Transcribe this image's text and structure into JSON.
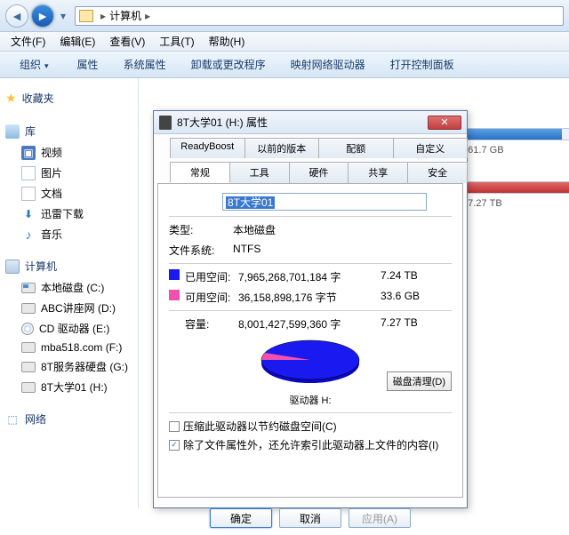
{
  "nav": {
    "location": "计算机"
  },
  "menu": {
    "file": "文件(F)",
    "edit": "编辑(E)",
    "view": "查看(V)",
    "tools": "工具(T)",
    "help": "帮助(H)"
  },
  "toolbar": {
    "organize": "组织",
    "properties": "属性",
    "sysprops": "系统属性",
    "uninstall": "卸载或更改程序",
    "mapdrive": "映射网络驱动器",
    "ctrlpanel": "打开控制面板"
  },
  "sidebar": {
    "fav": "收藏夹",
    "lib": "库",
    "lib_items": [
      "视频",
      "图片",
      "文档",
      "迅雷下载",
      "音乐"
    ],
    "computer": "计算机",
    "drives": [
      "本地磁盘 (C:)",
      "ABC讲座网 (D:)",
      "CD 驱动器 (E:)",
      "mba518.com (F:)",
      "8T服务器硬盘 (G:)",
      "8T大学01 (H:)"
    ],
    "network": "网络"
  },
  "caps": {
    "row1": ", 共 61.7 GB",
    "row2": ", 共 7.27 TB"
  },
  "dlg": {
    "title": "8T大学01 (H:) 属性",
    "tabs_top": [
      "ReadyBoost",
      "以前的版本",
      "配额",
      "自定义"
    ],
    "tabs_bot": [
      "常规",
      "工具",
      "硬件",
      "共享",
      "安全"
    ],
    "name": "8T大学01",
    "type_k": "类型:",
    "type_v": "本地磁盘",
    "fs_k": "文件系统:",
    "fs_v": "NTFS",
    "used_k": "已用空间:",
    "used_b": "7,965,268,701,184 字",
    "used_h": "7.24 TB",
    "free_k": "可用空间:",
    "free_b": "36,158,898,176 字节",
    "free_h": "33.6 GB",
    "cap_k": "容量:",
    "cap_b": "8,001,427,599,360 字",
    "cap_h": "7.27 TB",
    "drive_label": "驱动器 H:",
    "clean": "磁盘清理(D)",
    "chk1": "压缩此驱动器以节约磁盘空间(C)",
    "chk2": "除了文件属性外，还允许索引此驱动器上文件的内容(I)",
    "ok": "确定",
    "cancel": "取消",
    "apply": "应用(A)"
  },
  "chart_data": {
    "type": "pie",
    "title": "驱动器 H:",
    "series": [
      {
        "name": "已用空间",
        "value": 7965268701184,
        "color": "#1a1af0"
      },
      {
        "name": "可用空间",
        "value": 36158898176,
        "color": "#f050b0"
      }
    ]
  }
}
